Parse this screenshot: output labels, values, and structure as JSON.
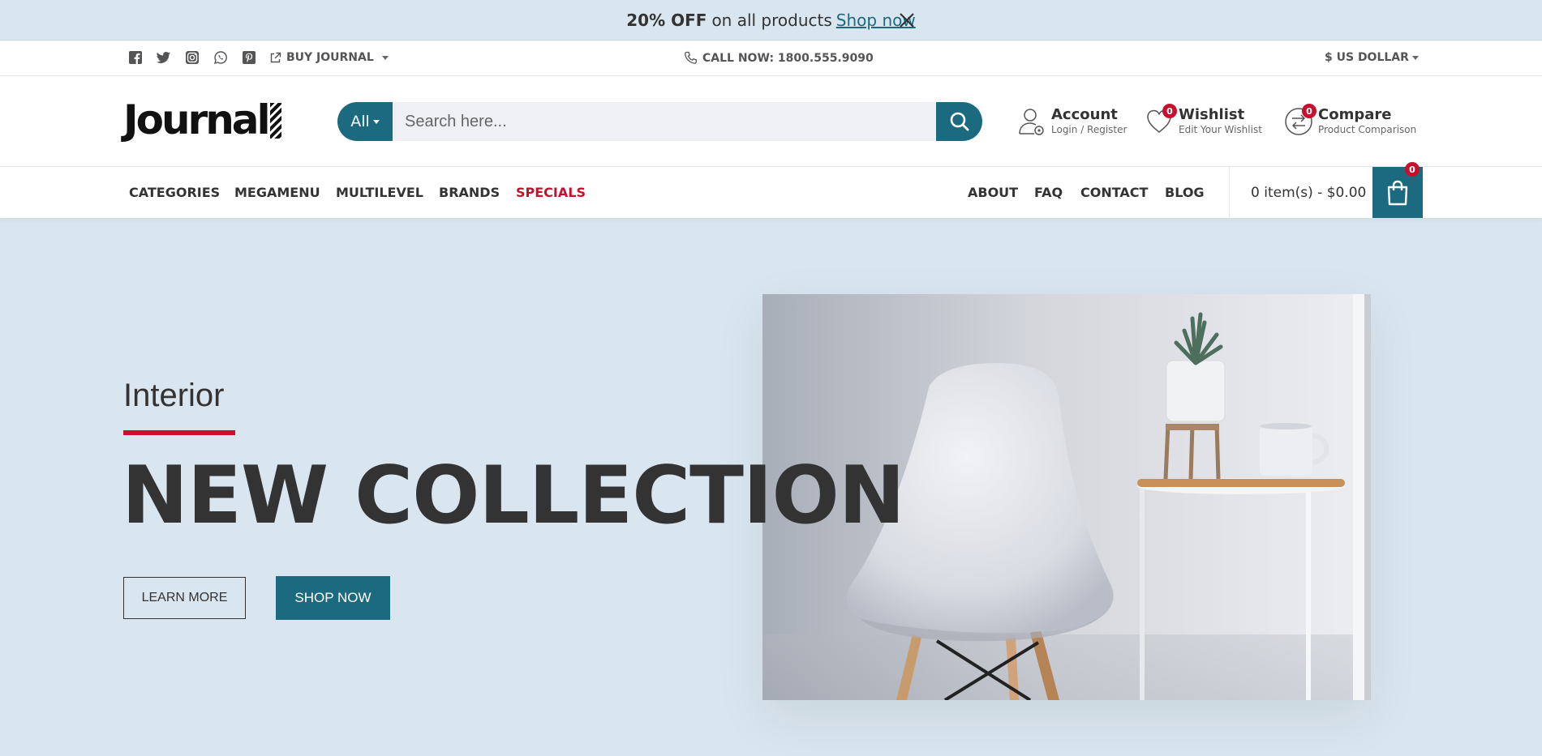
{
  "promo": {
    "strong": "20% OFF",
    "text": "on all products",
    "link": "Shop now"
  },
  "topbar": {
    "social_icons": [
      "facebook-icon",
      "twitter-icon",
      "instagram-icon",
      "whatsapp-icon",
      "pinterest-icon"
    ],
    "buy_label": "BUY JOURNAL",
    "call_label": "CALL NOW: 1800.555.9090",
    "currency_label": "$ US DOLLAR"
  },
  "header": {
    "logo": "Journal",
    "search": {
      "category": "All",
      "placeholder": "Search here..."
    },
    "account": {
      "title": "Account",
      "subtitle": "Login / Register"
    },
    "wishlist": {
      "title": "Wishlist",
      "subtitle": "Edit Your Wishlist",
      "count": "0"
    },
    "compare": {
      "title": "Compare",
      "subtitle": "Product Comparison",
      "count": "0"
    }
  },
  "nav": {
    "left": [
      "CATEGORIES",
      "MEGAMENU",
      "MULTILEVEL",
      "BRANDS",
      "SPECIALS"
    ],
    "right": [
      "ABOUT",
      "FAQ",
      "CONTACT",
      "BLOG"
    ],
    "cart_text": "0 item(s) - $0.00",
    "cart_count": "0"
  },
  "hero": {
    "subtitle": "Interior",
    "title": "NEW COLLECTION",
    "learn_more": "LEARN MORE",
    "shop_now": "SHOP NOW"
  },
  "colors": {
    "accent": "#1b6a80",
    "highlight": "#c8102e",
    "background": "#dae6ef"
  }
}
